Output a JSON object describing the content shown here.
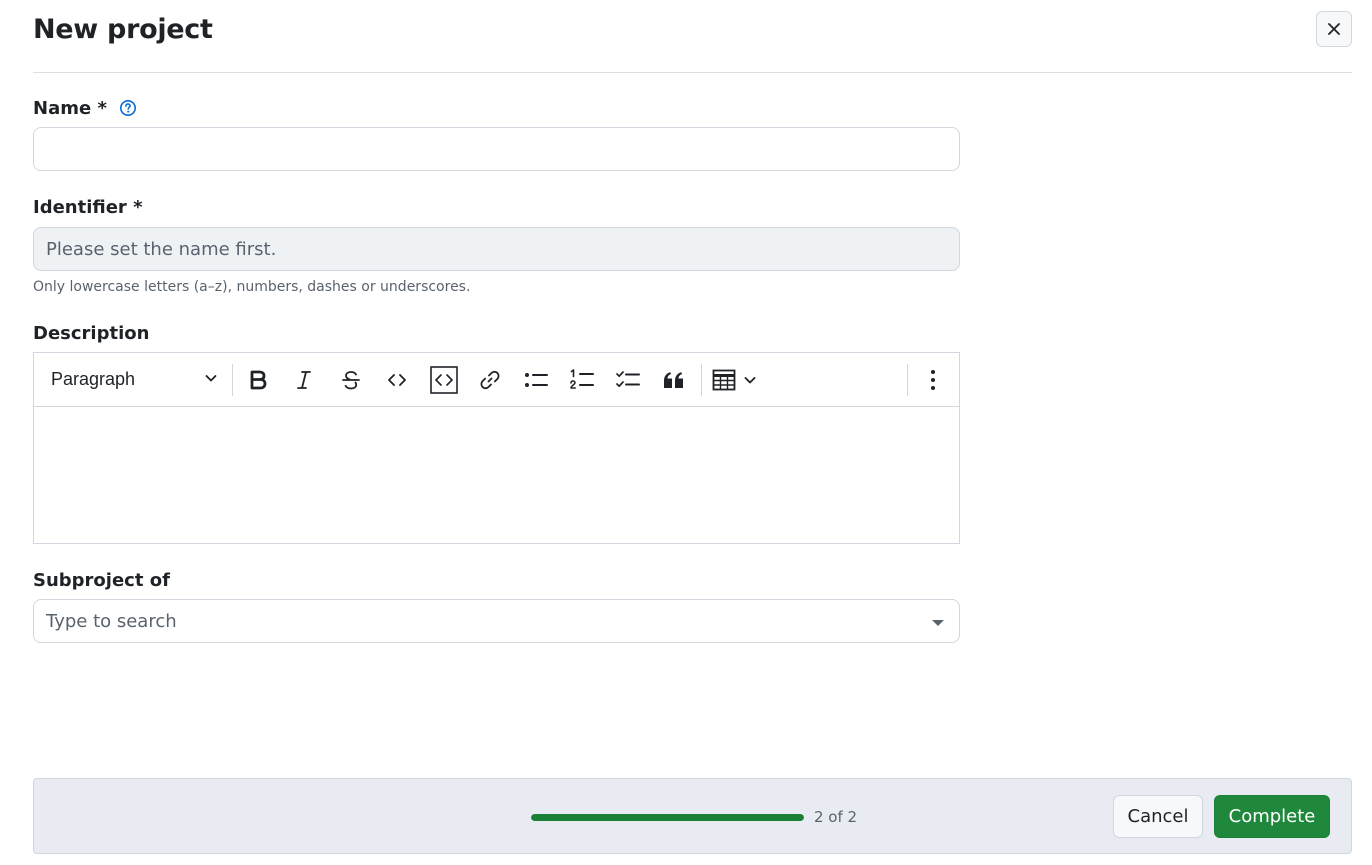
{
  "header": {
    "title": "New project",
    "close_icon": "x-icon"
  },
  "form": {
    "name": {
      "label": "Name *",
      "value": "",
      "help_icon": "question-circle-icon"
    },
    "identifier": {
      "label": "Identifier *",
      "placeholder": "Please set the name first.",
      "hint": "Only lowercase letters (a–z), numbers, dashes or underscores."
    },
    "description": {
      "label": "Description",
      "toolbar": {
        "paragraph_select": "Paragraph",
        "buttons": [
          "bold-icon",
          "italic-icon",
          "strikethrough-icon",
          "code-icon",
          "code-block-icon",
          "link-icon",
          "bulleted-list-icon",
          "numbered-list-icon",
          "task-list-icon",
          "blockquote-icon",
          "table-icon",
          "more-vertical-icon"
        ]
      },
      "value": ""
    },
    "subproject": {
      "label": "Subproject of",
      "placeholder": "Type to search"
    }
  },
  "footer": {
    "progress": 1.0,
    "step_text": "2 of 2",
    "cancel_label": "Cancel",
    "complete_label": "Complete",
    "accent_color": "#1f883d"
  }
}
